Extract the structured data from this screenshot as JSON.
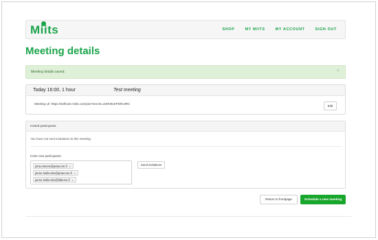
{
  "brand": {
    "logo": "Miits",
    "accent": "#1aa34a"
  },
  "nav": {
    "items": [
      "SHOP",
      "MY MIITS",
      "MY ACCOUNT",
      "SIGN OUT"
    ]
  },
  "page": {
    "title": "Meeting details"
  },
  "alert": {
    "message": "Meeting details saved.",
    "close": "×",
    "color": "#dff0d8"
  },
  "meeting": {
    "time": "Today 16:00, 1 hour",
    "name": "Test meeting",
    "url_text": "Meeting url: https://selfcare.miits.com/join?secret=uWK0txKPsfHUtRC",
    "edit_label": "Edit"
  },
  "participants": {
    "header": "Invited participants",
    "no_invitations": "You have not sent invitations to this meeting.",
    "invite_label": "Invite new participants:",
    "emails": [
      "juha.elonen@praecom.fi",
      "janne.halla-aho@praecom.fi",
      "janne.halla-aho@falkons.fi"
    ],
    "remove_icon": "×",
    "send_label": "Send invitations"
  },
  "actions": {
    "return_label": "Return to frontpage",
    "schedule_label": "Schedule a new meeting",
    "schedule_color": "#19a62c"
  }
}
